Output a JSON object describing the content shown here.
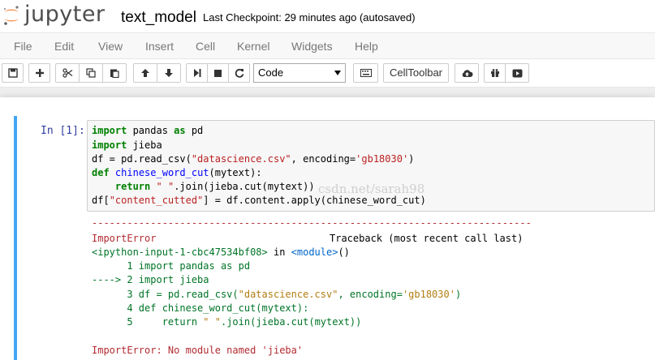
{
  "header": {
    "logo_text": "jupyter",
    "notebook_name": "text_model",
    "checkpoint": "Last Checkpoint: 29 minutes ago (autosaved)"
  },
  "menu": [
    "File",
    "Edit",
    "View",
    "Insert",
    "Cell",
    "Kernel",
    "Widgets",
    "Help"
  ],
  "toolbar": {
    "cell_type": "Code",
    "celltoolbar_label": "CellToolbar"
  },
  "cell": {
    "prompt": "In [1]:",
    "code": {
      "l1": [
        "import",
        " pandas ",
        "as",
        " pd"
      ],
      "l2": [
        "import",
        " jieba"
      ],
      "l3": [
        "df = pd.read_csv(",
        "\"datascience.csv\"",
        ", encoding=",
        "'gb18030'",
        ")"
      ],
      "l4": [
        "def",
        " ",
        "chinese_word_cut",
        "(mytext):"
      ],
      "l5": [
        "    ",
        "return",
        " ",
        "\" \"",
        ".join(jieba.cut(mytext))"
      ],
      "l6": [
        "df[",
        "\"content_cutted\"",
        "] = df.content.apply(chinese_word_cut)"
      ]
    },
    "watermark": "csdn.net/sarah98",
    "output": {
      "separator": "---------------------------------------------------------------------------",
      "error_name": "ImportError",
      "traceback_label": "Traceback (most recent call last)",
      "input_ref": "<ipython-input-1-cbc47534bf08>",
      "in_text": " in ",
      "module_ref": "<module>",
      "module_paren": "()",
      "tb1": [
        "      1 ",
        "import",
        " pandas ",
        "as",
        " pd"
      ],
      "tb2": [
        "----> 2 ",
        "import",
        " jieba"
      ],
      "tb3": [
        "      3 ",
        "df = pd.read_csv(",
        "\"datascience.csv\"",
        ", encoding=",
        "'gb18030'",
        ")"
      ],
      "tb4": [
        "      4 ",
        "def",
        " chinese_word_cut(mytext):"
      ],
      "tb5": [
        "      5     ",
        "return",
        " ",
        "\" \"",
        ".join(jieba.cut(mytext))"
      ],
      "final_error": "ImportError: No module named 'jieba'"
    }
  },
  "colors": {
    "cell_border_selected": "#42a5f5",
    "prompt": "#303f9f",
    "keyword": "#008000",
    "error": "#b22b31"
  }
}
